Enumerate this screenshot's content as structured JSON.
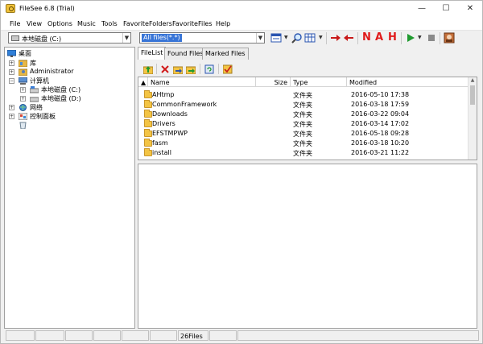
{
  "window": {
    "title": "FileSee 6.8 (Trial)",
    "minimize_glyph": "—",
    "maximize_glyph": "☐",
    "close_glyph": "✕"
  },
  "menu": [
    "File",
    "View",
    "Options",
    "Music",
    "Tools",
    "FavoriteFolders",
    "FavoriteFiles",
    "Help"
  ],
  "toolbar": {
    "drive_combo": "本地磁盘 (C:)",
    "filter_combo": "All files(*.*)",
    "letters": [
      "N",
      "A",
      "H"
    ],
    "icons": [
      "view-mode-icon",
      "search-icon",
      "columns-icon",
      "forward-red-arrow-icon",
      "back-red-arrow-icon",
      "play-icon",
      "stop-icon",
      "image-icon"
    ]
  },
  "tree": [
    {
      "label": "桌面",
      "icon": "desktop-icon"
    },
    {
      "label": "库",
      "icon": "library-icon"
    },
    {
      "label": "Administrator",
      "icon": "user-folder-icon"
    },
    {
      "label": "计算机",
      "icon": "computer-icon"
    },
    {
      "label": "本地磁盘 (C:)",
      "icon": "drive-c-icon"
    },
    {
      "label": "本地磁盘 (D:)",
      "icon": "drive-d-icon"
    },
    {
      "label": "网络",
      "icon": "network-icon"
    },
    {
      "label": "控制面板",
      "icon": "control-panel-icon"
    },
    {
      "label": "",
      "icon": "recycle-bin-icon"
    }
  ],
  "tabs": [
    "FileList",
    "Found Files",
    "Marked Files"
  ],
  "file_toolbar_icons": [
    "up-folder-icon",
    "delete-icon",
    "copy-icon",
    "move-icon",
    "refresh-icon",
    "mark-icon"
  ],
  "columns": {
    "name": "Name",
    "size": "Size",
    "type": "Type",
    "modified": "Modified"
  },
  "files": [
    {
      "name": "AHtmp",
      "size": "",
      "type": "文件夹",
      "modified": "2016-05-10 17:38"
    },
    {
      "name": "CommonFramework",
      "size": "",
      "type": "文件夹",
      "modified": "2016-03-18 17:59"
    },
    {
      "name": "Downloads",
      "size": "",
      "type": "文件夹",
      "modified": "2016-03-22 09:04"
    },
    {
      "name": "Drivers",
      "size": "",
      "type": "文件夹",
      "modified": "2016-03-14 17:02"
    },
    {
      "name": "EFSTMPWP",
      "size": "",
      "type": "文件夹",
      "modified": "2016-05-18 09:28"
    },
    {
      "name": "fasm",
      "size": "",
      "type": "文件夹",
      "modified": "2016-03-18 10:20"
    },
    {
      "name": "install",
      "size": "",
      "type": "文件夹",
      "modified": "2016-03-21 11:22"
    }
  ],
  "status": {
    "count": "26Files"
  },
  "colors": {
    "accent": "#3875d7",
    "letters": "#e01a1a",
    "folder": "#f3c444"
  }
}
